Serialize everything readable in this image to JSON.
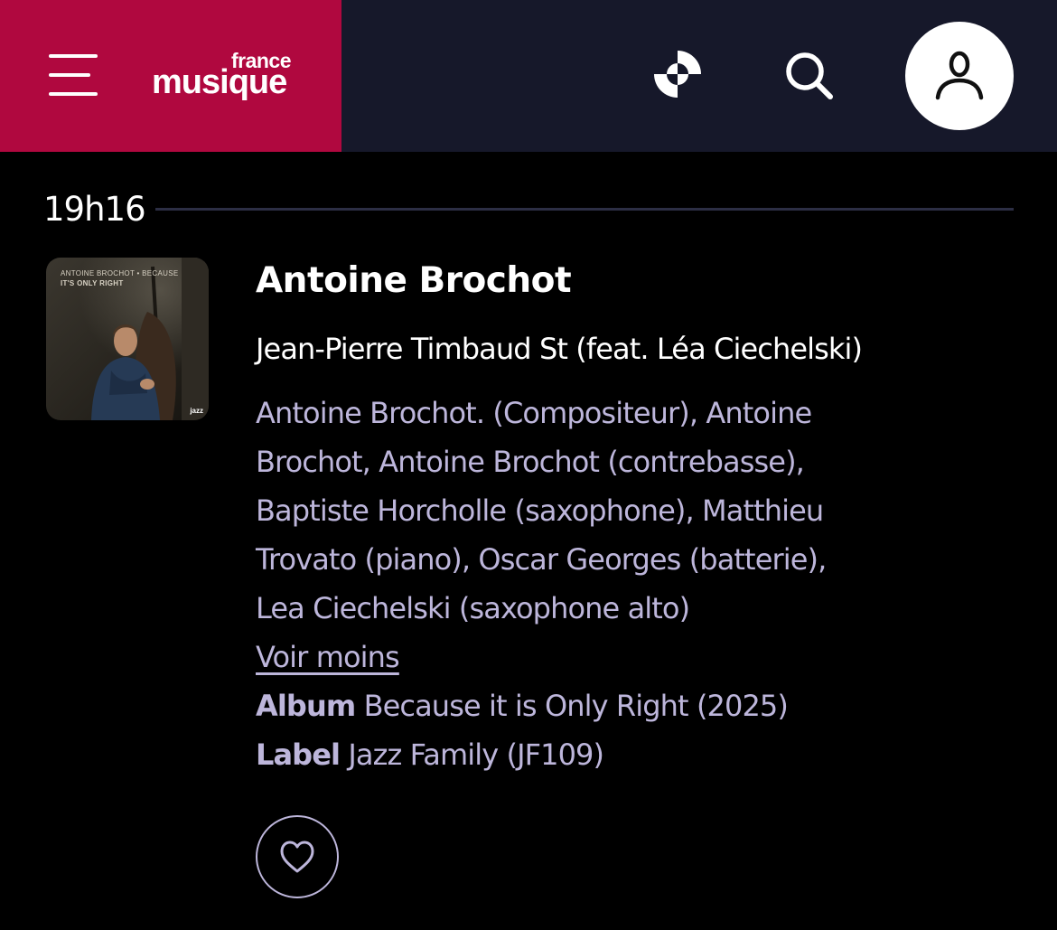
{
  "header": {
    "menu_icon": "hamburger-menu-icon",
    "logo_small": "france",
    "logo_big": "musique",
    "live_icon": "live-radio-icon",
    "search_icon": "search-icon",
    "account_icon": "user-icon",
    "brand_color": "#b0083f",
    "bar_color": "#16182a"
  },
  "timeline": {
    "time": "19h16"
  },
  "track": {
    "cover_title_line1": "ANTOINE BROCHOT • BECAUSE",
    "cover_title_line2": "IT'S ONLY RIGHT",
    "cover_label": "jazz",
    "artist": "Antoine Brochot",
    "title": "Jean-Pierre Timbaud St (feat. Léa Ciechelski)",
    "credits_lines": [
      "Antoine Brochot. (Compositeur), Antoine",
      "Brochot, Antoine Brochot (contrebasse),",
      "Baptiste Horcholle (saxophone), Matthieu",
      "Trovato (piano), Oscar Georges (batterie),",
      "Lea Ciechelski (saxophone alto)"
    ],
    "toggle_label": "Voir moins",
    "album_label": "Album",
    "album_value": "Because it is Only Right (2025)",
    "label_label": "Label",
    "label_value": "Jazz Family (JF109)",
    "favorite_icon": "heart-icon"
  }
}
